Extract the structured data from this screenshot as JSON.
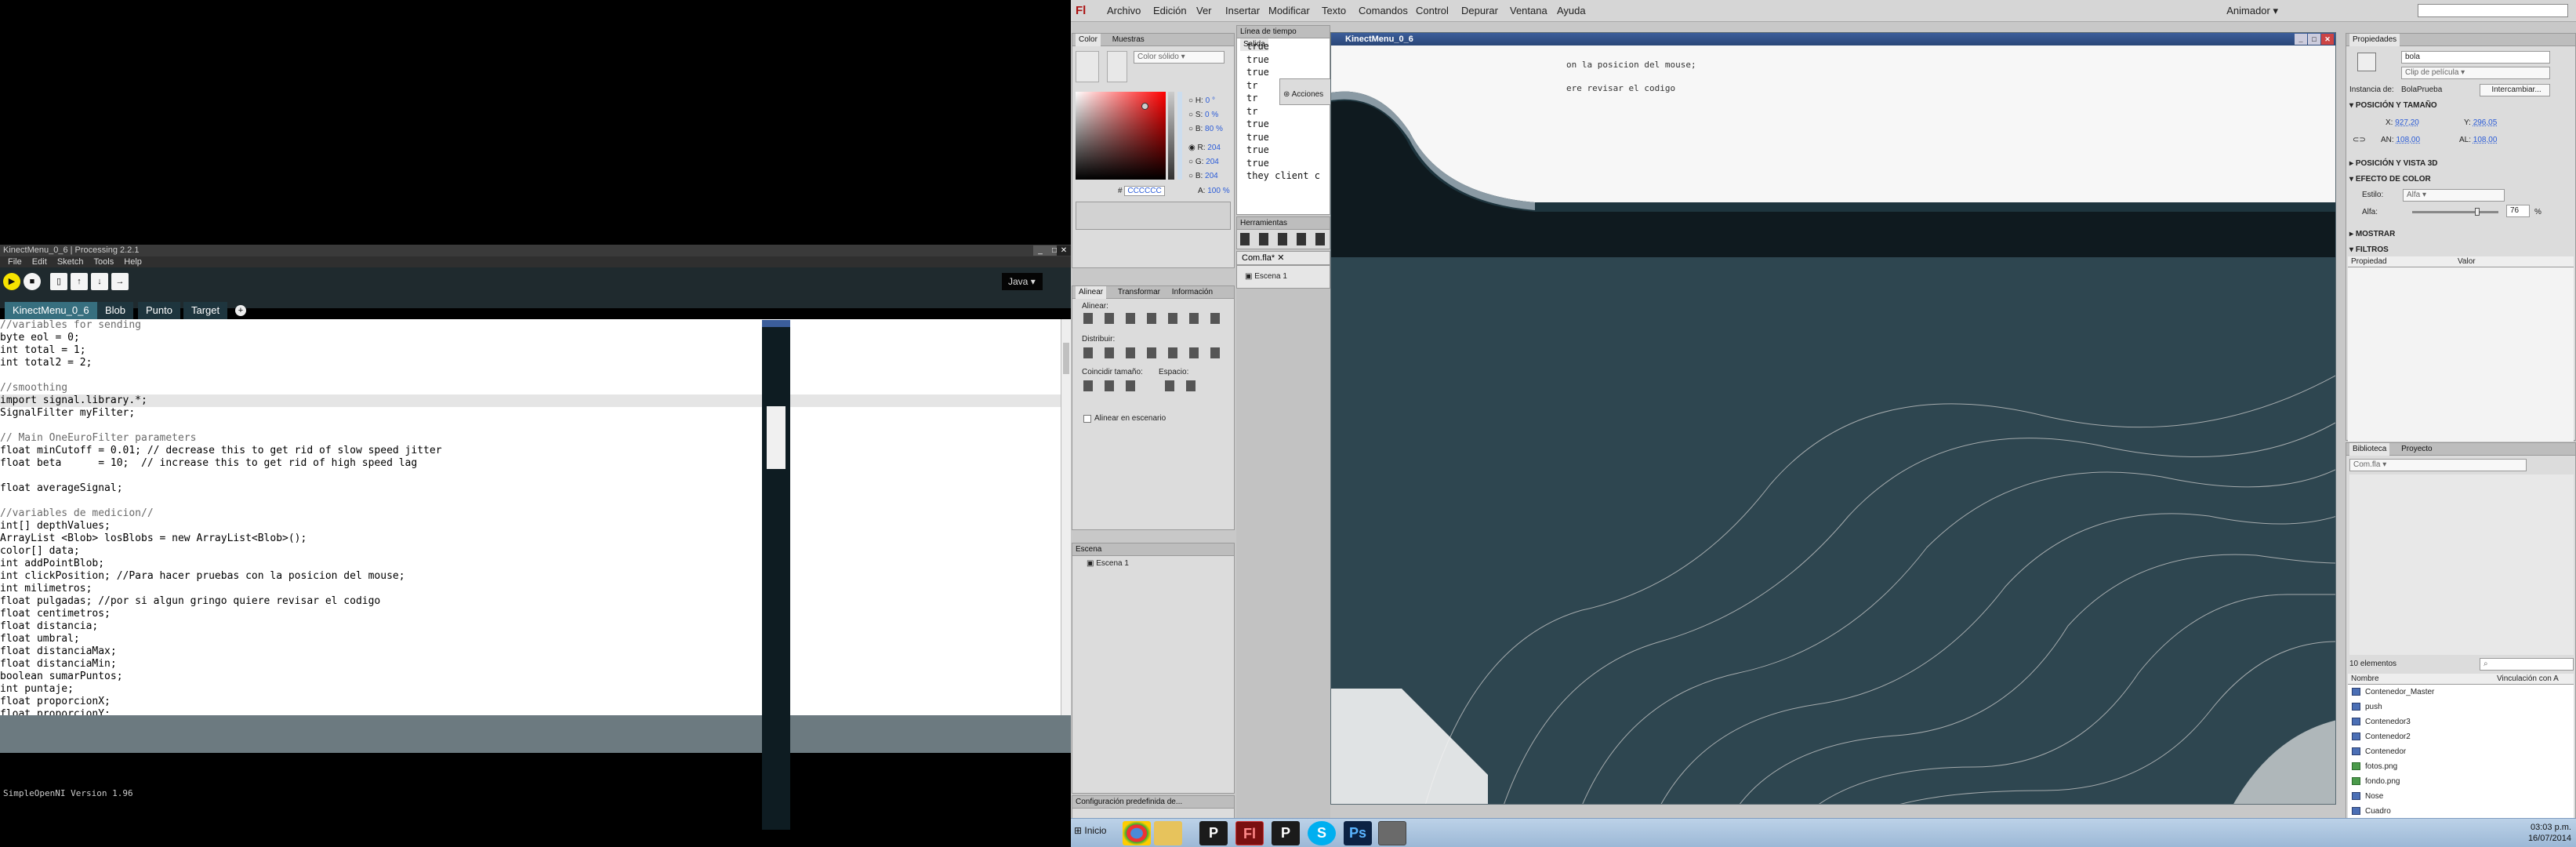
{
  "processing": {
    "title": "KinectMenu_0_6 | Processing 2.2.1",
    "menu": [
      "File",
      "Edit",
      "Sketch",
      "Tools",
      "Help"
    ],
    "mode": "Java",
    "tabs": [
      "KinectMenu_0_6",
      "Blob",
      "Punto",
      "Target"
    ],
    "code": [
      "//variables for sending",
      "byte eol = 0;",
      "int total = 1;",
      "int total2 = 2;",
      "",
      "//smoothing",
      "import signal.library.*;",
      "SignalFilter myFilter;",
      "",
      "// Main OneEuroFilter parameters",
      "float minCutoff = 0.01; // decrease this to get rid of slow speed jitter",
      "float beta      = 10;  // increase this to get rid of high speed lag",
      "",
      "float averageSignal;",
      "",
      "//variables de medicion//",
      "int[] depthValues;",
      "ArrayList <Blob> losBlobs = new ArrayList<Blob>();",
      "color[] data;",
      "int addPointBlob;",
      "int clickPosition; //Para hacer pruebas con la posicion del mouse;",
      "int milimetros;",
      "float pulgadas; //por si algun gringo quiere revisar el codigo",
      "float centimetros;",
      "float distancia;",
      "float umbral;",
      "float distanciaMax;",
      "float distanciaMin;",
      "boolean sumarPuntos;",
      "int puntaje;",
      "float proporcionX;",
      "float proporcionY;"
    ],
    "console": "SimpleOpenNI Version 1.96"
  },
  "flash": {
    "logo": "Fl",
    "menu": [
      "Archivo",
      "Edición",
      "Ver",
      "Insertar",
      "Modificar",
      "Texto",
      "Comandos",
      "Control",
      "Depurar",
      "Ventana",
      "Ayuda"
    ],
    "workspace": "Animador",
    "color_panel": {
      "tabs": [
        "Color",
        "Muestras"
      ],
      "type": "Color sólido",
      "H": "0 °",
      "S": "0 %",
      "B": "80 %",
      "R": "204",
      "G": "204",
      "B2": "204",
      "hex": "CCCCCC",
      "A": "100 %"
    },
    "timeline_tabs": [
      "Línea de tiempo",
      "Salida"
    ],
    "output_lines": [
      "true",
      "true",
      "true",
      "tr",
      "tr",
      "tr",
      "true",
      "true",
      "true",
      "true",
      "they client c"
    ],
    "acciones": "Acciones",
    "herramientas": "Herramientas",
    "align_panel": {
      "tabs": [
        "Alinear",
        "Transformar",
        "Información"
      ],
      "alinear": "Alinear:",
      "distribuir": "Distribuir:",
      "coincidir": "Coincidir tamaño:",
      "espacio": "Espacio:",
      "escenario": "Alinear en escenario"
    },
    "doc_tab": "Com.fla*",
    "scene_item": "Escena 1",
    "escena_panel": {
      "title": "Escena",
      "item": "Escena 1"
    },
    "config_title": "Configuración predefinida de...",
    "kinect": {
      "title": "KinectMenu_0_6",
      "text1": "on la posicion del mouse;",
      "text2": "ere revisar el codigo"
    },
    "properties": {
      "tab": "Propiedades",
      "name": "bola",
      "type": "Clip de película",
      "instance_label": "Instancia de:",
      "instance": "BolaPrueba",
      "swap": "Intercambiar...",
      "pos_section": "POSICIÓN Y TAMAÑO",
      "x": "927,20",
      "y": "296,05",
      "an": "108,00",
      "al": "108,00",
      "pos3d": "POSICIÓN Y VISTA 3D",
      "efecto": "EFECTO DE COLOR",
      "estilo_label": "Estilo:",
      "estilo": "Alfa",
      "alfa_label": "Alfa:",
      "alfa": "76",
      "alfa_pct": "%",
      "mostrar": "MOSTRAR",
      "filtros": "FILTROS",
      "col_prop": "Propiedad",
      "col_val": "Valor"
    },
    "library": {
      "tabs": [
        "Biblioteca",
        "Proyecto"
      ],
      "file": "Com.fla",
      "count": "10 elementos",
      "col_name": "Nombre",
      "col_link": "Vinculación con A",
      "items": [
        {
          "name": "Contenedor_Master",
          "type": "symbol"
        },
        {
          "name": "push",
          "type": "symbol"
        },
        {
          "name": "Contenedor3",
          "type": "symbol"
        },
        {
          "name": "Contenedor2",
          "type": "symbol"
        },
        {
          "name": "Contenedor",
          "type": "symbol"
        },
        {
          "name": "fotos.png",
          "type": "image"
        },
        {
          "name": "fondo.png",
          "type": "image"
        },
        {
          "name": "Nose",
          "type": "symbol"
        },
        {
          "name": "Cuadro",
          "type": "symbol"
        }
      ]
    }
  },
  "taskbar": {
    "start": "Inicio",
    "apps": [
      "chrome-icon",
      "explorer-icon",
      "processing-icon",
      "flash-icon",
      "processing-icon",
      "skype-icon",
      "photoshop-icon",
      "window-icon"
    ],
    "time": "03:03 p.m.",
    "date": "16/07/2014"
  }
}
